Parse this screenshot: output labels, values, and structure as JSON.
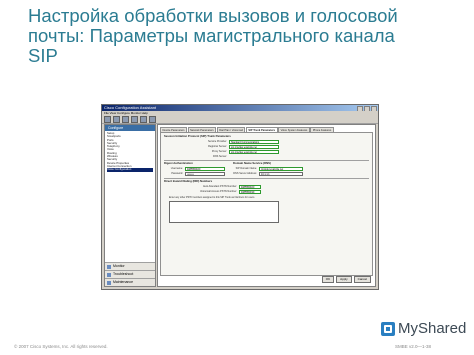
{
  "slide": {
    "title_lines": [
      "Настройка обработки вызовов и голосовой",
      "почты: Параметры магистрального канала",
      "SIP"
    ],
    "copyright": "© 2007 Cisco Systems, Inc. All rights reserved.",
    "course_code": "SMBE v2.0—1-38",
    "logo_text": "MyShared"
  },
  "window": {
    "title": "Cisco Configuration Assistant",
    "menu": "File  View  Configure  Monitor  Help",
    "sidebar_header": "Configure",
    "tree": [
      "Setup",
      "Smartports",
      "Ports",
      "Security",
      "Telephony",
      "Voice",
      "Routing",
      "Wireless",
      "Security",
      "Device Properties",
      "Internet Connection",
      "Voice Configuration"
    ],
    "tree_selected_index": 11,
    "sidebar_footer": [
      "Monitor",
      "Troubleshoot",
      "Maintenance"
    ],
    "tabs": [
      "Device Parameters",
      "Network Parameters",
      "Dial Plan / Voicemail",
      "SIP Trunk Parameters",
      "Voice System Features",
      "Phone Features",
      "Auto Attendant"
    ],
    "active_tab_index": 3,
    "sip_group": {
      "title": "Session Initiation Protocol (SIP) Trunk Parameters",
      "fields": [
        {
          "label": "Service Provider:",
          "value": "Standard Communications",
          "highlight": true
        },
        {
          "label": "Registrar Server:",
          "value": "sip.provider.example.net",
          "highlight": true
        },
        {
          "label": "Proxy Server:",
          "value": "sip.provider.example.net",
          "highlight": true
        },
        {
          "label": "DNS Server:",
          "value": "",
          "highlight": false
        }
      ]
    },
    "auth_group": {
      "title": "Digest Authentication",
      "fields": [
        {
          "label": "Username:",
          "value": "4085550100",
          "highlight": true
        },
        {
          "label": "Password:",
          "value": "••••••••",
          "highlight": false
        }
      ]
    },
    "domain_group": {
      "title": "Domain Name Service (DNS)",
      "fields": [
        {
          "label": "SIP Domain Name:",
          "value": "provider.example.net",
          "highlight": true
        },
        {
          "label": "DNS Server Address:",
          "value": "10.1.1.1",
          "highlight": false
        }
      ]
    },
    "did_group": {
      "title": "Direct Inward Dialing (DID) Numbers",
      "fields": [
        {
          "label": "Auto Attendant PSTN Number:",
          "value": "4085550100",
          "highlight": true
        },
        {
          "label": "Voicemail Access PSTN Number:",
          "value": "4085550199",
          "highlight": true
        }
      ],
      "note": "Enter any other PSTN numbers assigned to this SIP Trunk as Numbers for users."
    },
    "buttons": [
      "OK",
      "Apply",
      "Cancel"
    ]
  }
}
